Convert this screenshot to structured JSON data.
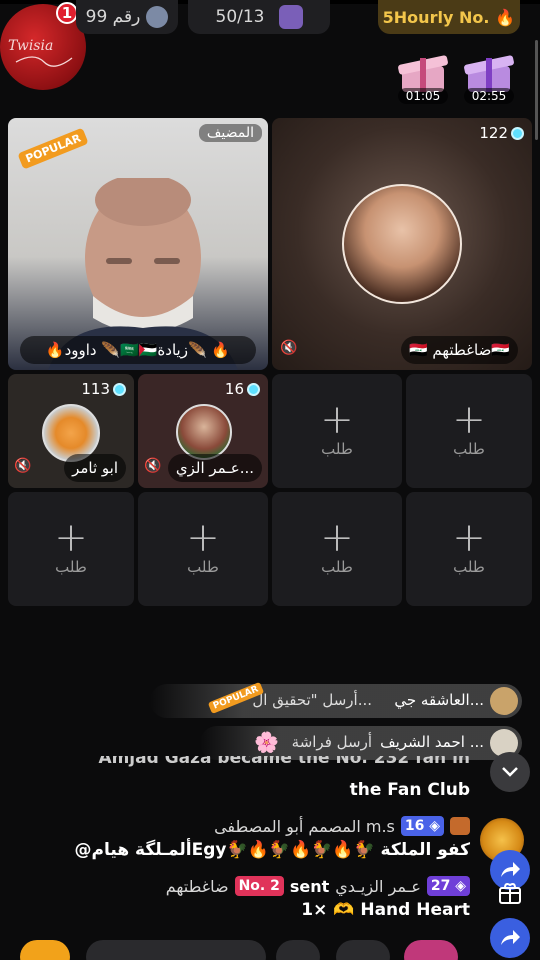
{
  "header": {
    "room_badge_count": "1",
    "room_label": "رقم 99",
    "members": "50/13",
    "hourly_label": "5Hourly No.",
    "logo_text": "Twisia",
    "gift_timers": [
      "01:05",
      "02:55"
    ]
  },
  "seats": {
    "host_label": "المضيف",
    "popular_badge": "POPULAR",
    "host_name": "🔥داوود 🪶🇸🇦🇵🇸زيادة🪶 🔥",
    "seat2_count": "122",
    "seat2_name": "🇮🇶 ضاغطتهم🇮🇶",
    "seat3_count": "113",
    "seat3_name": "ابو ثامر",
    "seat4_count": "16",
    "seat4_name": "عـمر الزي...",
    "request_label": "طلب"
  },
  "chat": {
    "notice1_user": "العاشقه جي...",
    "notice1_text": "أرسل \"تحقيق ال...",
    "notice2_user": "احمد الشريف ...",
    "notice2_text": "أرسل فراشة",
    "fanclub_partial": "Amjad Gaza became the No. 232 fan in",
    "fanclub_line2": "the Fan Club",
    "msg1_level": "16",
    "msg1_user": "المصمم أبو المصطفى m.s",
    "msg1_text": "@ألمـلگة هيامEgy🐓🔥🐓🔥🐓🔥🐓 كفو الملكة",
    "msg2_level": "27",
    "msg2_user": "عـمر الزيـدي",
    "msg2_sent": "sent",
    "msg2_rank": "No. 2",
    "msg2_target": "ضاغطتهم",
    "msg2_gift": "1× 🫶 Hand Heart"
  },
  "colors": {
    "accent_gold": "#f3c64b",
    "seat_bg": "#1c1c1f",
    "level_blue": "#4a63e8",
    "level_purple": "#6f3fd8",
    "rank_red": "#e0335a"
  }
}
